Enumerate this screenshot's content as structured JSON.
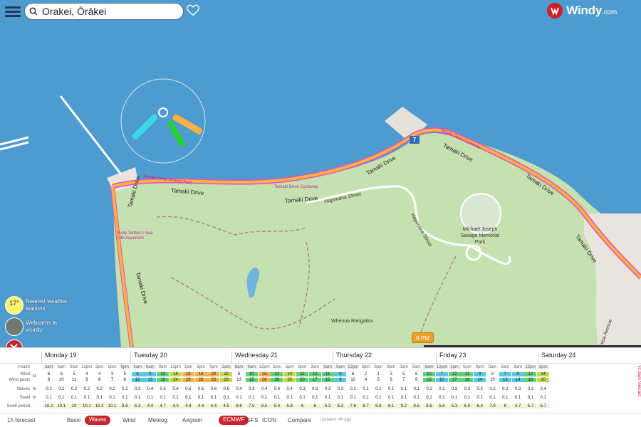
{
  "search": {
    "value": "Orakei, Ōrākei"
  },
  "brand": {
    "name": "Windy",
    "domain": ".com"
  },
  "widgets": {
    "temperature": {
      "value": "17°",
      "label": "Nearest weather stations"
    },
    "webcams": {
      "label": "Webcams in vicinity"
    }
  },
  "map_labels": {
    "road1": "Tamaki Drive",
    "road2": "Tamaki Drive",
    "road3": "Tamaki Drive",
    "road4": "Tamaki Drive",
    "road5": "Tamaki Drive",
    "road6": "Tamaki Drive",
    "road7": "Tamaki Drive",
    "road8": "Tamaki Drive",
    "cycleway1": "Tamaki Drive Cycleway",
    "cycleway2": "Tamaki Drive Cycleway",
    "shared_path": "Tamaki Drive Shared Path",
    "hapimana1": "Hapimana Street",
    "hapimana2": "Hapimana Street",
    "park": "Michael Joseph Savage Memorial Park",
    "whenua": "Whenua Rangatira",
    "aquarium": "Kelly Tarlton's Sea Life Aquarium",
    "ngapipi": "Ngapipi Road",
    "avenue": "Kepa Avenue",
    "route": "7"
  },
  "timeline": {
    "time": "8 PM"
  },
  "days": [
    "Monday 19",
    "Tuesday 20",
    "Wednesday 21",
    "Thursday 22",
    "Friday 23",
    "Saturday 24"
  ],
  "row_labels": {
    "hours": "Hours",
    "wind": "Wind",
    "gusts": "Wind gusts",
    "waves": "Waves",
    "swell": "Swell",
    "swell_period": "Swell period"
  },
  "units": {
    "wind": "kt",
    "waves": "m",
    "swell": "m"
  },
  "hours": [
    "3am",
    "6am",
    "9am",
    "12pm",
    "3pm",
    "6pm",
    "9pm"
  ],
  "wind": [
    6,
    6,
    5,
    4,
    4,
    3,
    5,
    8,
    9,
    12,
    16,
    19,
    18,
    20,
    15,
    6,
    10,
    18,
    12,
    14,
    11,
    12,
    11,
    9,
    6,
    2,
    1,
    3,
    5,
    6,
    10,
    7,
    12,
    11,
    8,
    6,
    7,
    9,
    12,
    14
  ],
  "gusts": [
    9,
    10,
    11,
    9,
    8,
    7,
    8,
    12,
    13,
    18,
    24,
    29,
    28,
    33,
    28,
    13,
    15,
    28,
    29,
    30,
    20,
    17,
    15,
    9,
    10,
    4,
    5,
    6,
    7,
    9,
    15,
    10,
    17,
    16,
    14,
    10,
    13,
    14,
    18,
    20
  ],
  "waves": [
    0.2,
    0.2,
    0.2,
    0.2,
    0.2,
    0.2,
    0.2,
    0.3,
    0.4,
    0.5,
    0.6,
    0.6,
    0.6,
    0.6,
    0.6,
    0.4,
    0.3,
    0.4,
    0.4,
    0.4,
    0.3,
    0.3,
    0.3,
    0.3,
    0.2,
    0.1,
    0.1,
    0.1,
    0.1,
    0.1,
    0.2,
    0.2,
    0.3,
    0.3,
    0.3,
    0.2,
    0.2,
    0.3,
    0.3,
    0.4
  ],
  "swell": [
    0.1,
    0.1,
    0.1,
    0.1,
    0.1,
    0.1,
    0.1,
    0.1,
    0.1,
    0.1,
    0.1,
    0.1,
    0.1,
    0.1,
    0.1,
    0.1,
    0.1,
    0.1,
    0.1,
    0.1,
    0.1,
    0.1,
    0.1,
    0.1,
    0.1,
    0.1,
    0.1,
    0.1,
    0.1,
    0.1,
    0.1,
    0.1,
    0.1,
    0.1,
    0.1,
    0.1,
    0.1,
    0.1,
    0.1,
    0.1
  ],
  "swell_period": [
    10.2,
    10.1,
    10,
    10.1,
    10.2,
    10.1,
    8.9,
    6.3,
    4.4,
    4.7,
    4.3,
    4.4,
    4.4,
    4.4,
    4.5,
    8.6,
    7.5,
    8.5,
    5.4,
    5.8,
    6,
    6,
    5.3,
    5.2,
    7.6,
    8.7,
    8.9,
    9.1,
    9.2,
    8.5,
    8.8,
    5.8,
    5.3,
    6.5,
    6.3,
    7.9,
    8,
    4.7,
    5.7,
    5.7
  ],
  "bottom": {
    "forecast_1h": "1h forecast",
    "basic": "Basic",
    "waves": "Waves",
    "wind": "Wind",
    "meteog": "Meteog.",
    "airgram": "Airgram",
    "ecmwf": "ECMWF",
    "gfs": "GFS",
    "icon": "ICON",
    "compare": "Compare",
    "updated": "Updated: 4h ago",
    "side": "10 days forecast"
  },
  "colors": {
    "sea": "#4e9bcf",
    "land": "#c6e1b0",
    "road": "#f5b343",
    "cycleway": "#e84fbd",
    "accent": "#c8242b"
  }
}
